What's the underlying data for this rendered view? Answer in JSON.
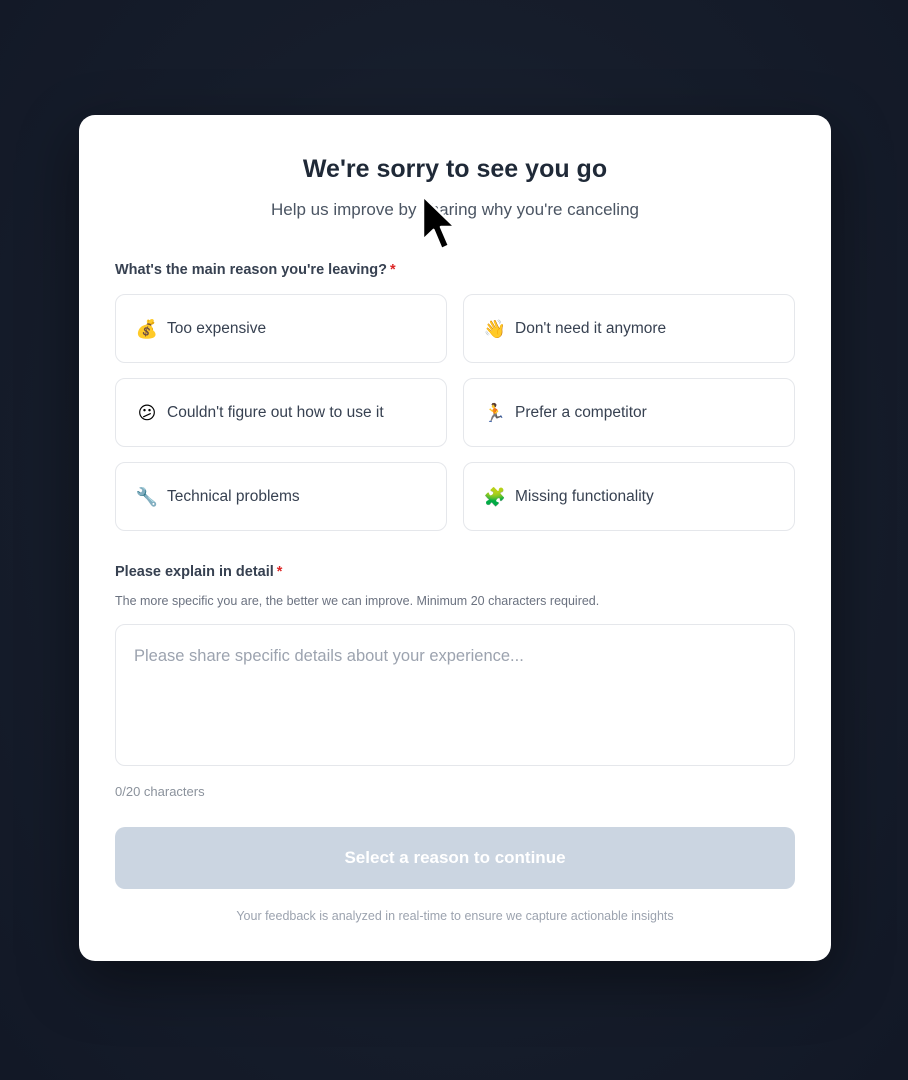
{
  "header": {
    "title": "We're sorry to see you go",
    "subtitle": "Help us improve by sharing why you're canceling"
  },
  "reason": {
    "label": "What's the main reason you're leaving?",
    "required_mark": "*",
    "options": [
      {
        "icon": "money-bag-icon",
        "glyph": "💰",
        "label": "Too expensive"
      },
      {
        "icon": "waving-hand-icon",
        "glyph": "👋",
        "label": "Don't need it anymore"
      },
      {
        "icon": "confused-face-icon",
        "glyph": "😕",
        "label": "Couldn't figure out how to use it"
      },
      {
        "icon": "running-person-icon",
        "glyph": "🏃",
        "label": "Prefer a competitor"
      },
      {
        "icon": "wrench-icon",
        "glyph": "🔧",
        "label": "Technical problems"
      },
      {
        "icon": "puzzle-piece-icon",
        "glyph": "🧩",
        "label": "Missing functionality"
      }
    ]
  },
  "detail": {
    "label": "Please explain in detail",
    "required_mark": "*",
    "help": "The more specific you are, the better we can improve. Minimum 20 characters required.",
    "placeholder": "Please share specific details about your experience...",
    "value": "",
    "counter": "0/20 characters"
  },
  "submit": {
    "label": "Select a reason to continue",
    "disabled": true
  },
  "footnote": "Your feedback is analyzed in real-time to ensure we capture actionable insights",
  "colors": {
    "backdrop": "#161d2b",
    "modal": "#ffffff",
    "required": "#dc2626",
    "button_disabled": "#cbd5e1"
  }
}
